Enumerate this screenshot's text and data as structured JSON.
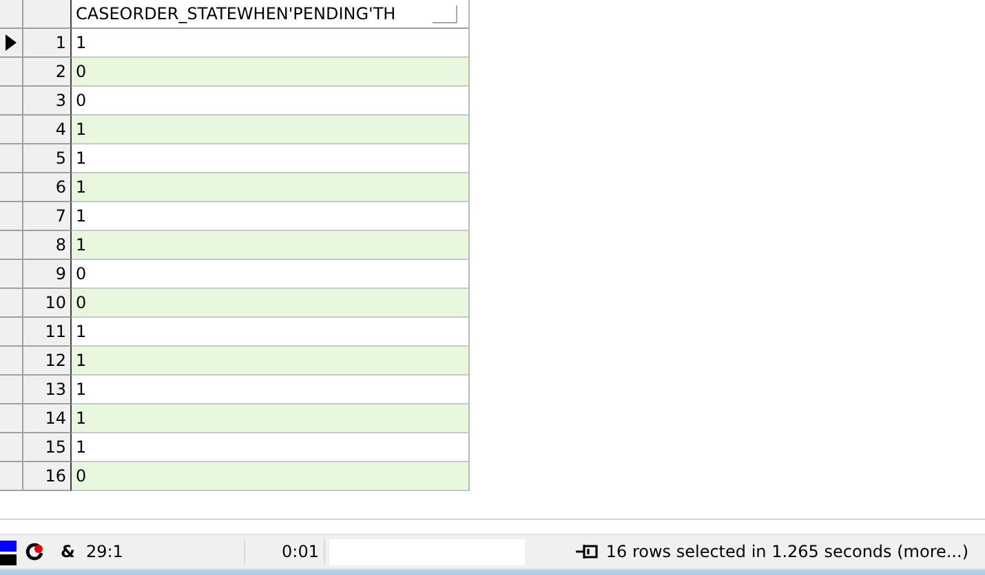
{
  "grid": {
    "columns": [
      {
        "label": "CASEORDER_STATEWHEN'PENDING'TH"
      }
    ],
    "rows": [
      {
        "number": "1",
        "value": "1",
        "current": true
      },
      {
        "number": "2",
        "value": "0",
        "current": false
      },
      {
        "number": "3",
        "value": "0",
        "current": false
      },
      {
        "number": "4",
        "value": "1",
        "current": false
      },
      {
        "number": "5",
        "value": "1",
        "current": false
      },
      {
        "number": "6",
        "value": "1",
        "current": false
      },
      {
        "number": "7",
        "value": "1",
        "current": false
      },
      {
        "number": "8",
        "value": "1",
        "current": false
      },
      {
        "number": "9",
        "value": "0",
        "current": false
      },
      {
        "number": "10",
        "value": "0",
        "current": false
      },
      {
        "number": "11",
        "value": "1",
        "current": false
      },
      {
        "number": "12",
        "value": "1",
        "current": false
      },
      {
        "number": "13",
        "value": "1",
        "current": false
      },
      {
        "number": "14",
        "value": "1",
        "current": false
      },
      {
        "number": "15",
        "value": "1",
        "current": false
      },
      {
        "number": "16",
        "value": "0",
        "current": false
      }
    ]
  },
  "status_bar": {
    "symbol": "&",
    "position": "29:1",
    "elapsed": "0:01",
    "message": "16 rows selected in 1.265 seconds (more...)"
  }
}
